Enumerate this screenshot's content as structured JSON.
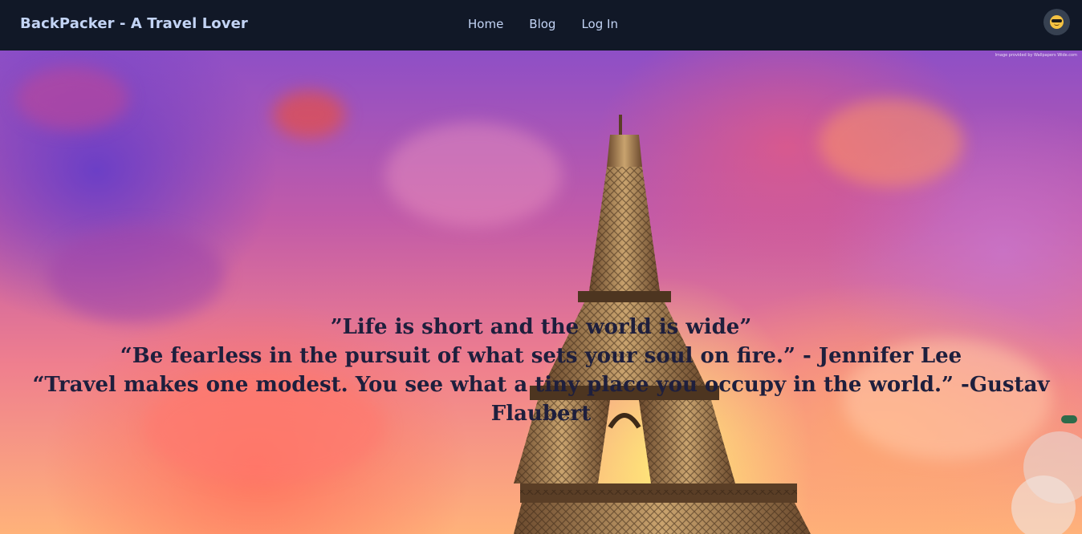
{
  "navbar": {
    "brand": "BackPacker - A Travel Lover",
    "links": [
      {
        "label": "Home"
      },
      {
        "label": "Blog"
      },
      {
        "label": "Log In"
      }
    ],
    "avatar_icon": "sunglasses-emoji-icon"
  },
  "hero": {
    "image_credit": "Image provided by Wallpapers Wide.com",
    "quotes": [
      "”Life is short and the world is wide”",
      "“Be fearless in the pursuit of what sets your soul on fire.” - Jennifer Lee",
      "“Travel makes one modest. You see what a tiny place you occupy in the world.” -Gustav Flaubert"
    ]
  },
  "colors": {
    "navbar_bg": "#111827",
    "nav_text": "#c3d4f5",
    "quote_text": "#1e1f3d"
  }
}
